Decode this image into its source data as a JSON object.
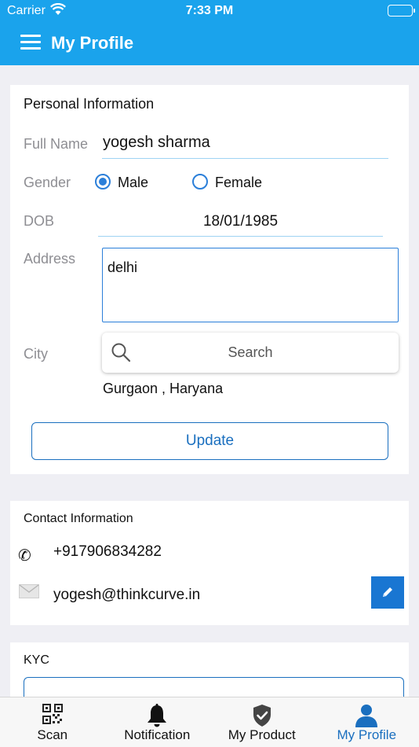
{
  "status": {
    "carrier": "Carrier",
    "time": "7:33 PM"
  },
  "header": {
    "title": "My Profile"
  },
  "personal": {
    "title": "Personal Information",
    "full_name_label": "Full Name",
    "full_name_value": "yogesh sharma",
    "gender_label": "Gender",
    "gender_options": [
      "Male",
      "Female"
    ],
    "gender_selected": "Male",
    "dob_label": "DOB",
    "dob_value": "18/01/1985",
    "address_label": "Address",
    "address_value": "delhi",
    "city_label": "City",
    "city_search_placeholder": "Search",
    "city_value": "Gurgaon , Haryana",
    "update_label": "Update"
  },
  "contact": {
    "title": "Contact Information",
    "phone": "+917906834282",
    "email": "yogesh@thinkcurve.in"
  },
  "kyc": {
    "title": "KYC"
  },
  "tabs": [
    {
      "label": "Scan",
      "icon": "qr-code-icon"
    },
    {
      "label": "Notification",
      "icon": "bell-icon"
    },
    {
      "label": "My Product",
      "icon": "shield-check-icon"
    },
    {
      "label": "My Profile",
      "icon": "user-icon",
      "active": true
    }
  ],
  "colors": {
    "primary": "#1aa3ec",
    "accent": "#1a6fbf",
    "background": "#efeff4"
  }
}
